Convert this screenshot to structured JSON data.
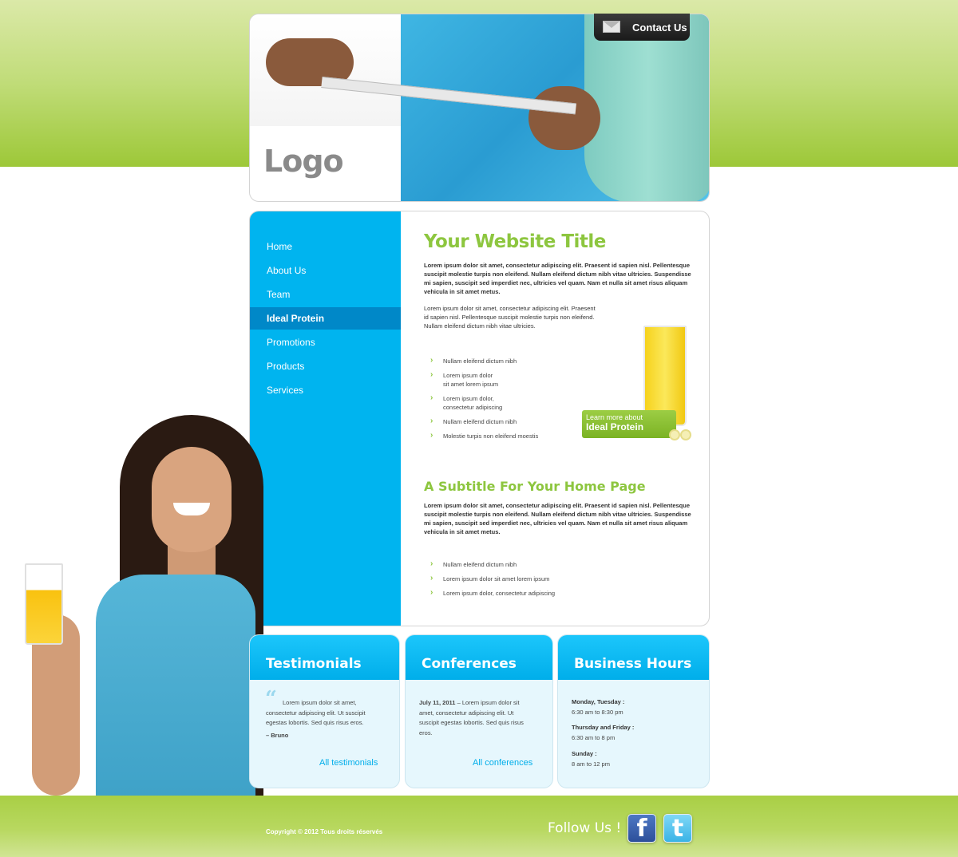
{
  "header": {
    "logo": "Logo",
    "contact_label": "Contact Us"
  },
  "nav": {
    "items": [
      {
        "label": "Home",
        "active": false
      },
      {
        "label": "About Us",
        "active": false
      },
      {
        "label": "Team",
        "active": false
      },
      {
        "label": "Ideal Protein",
        "active": true
      },
      {
        "label": "Promotions",
        "active": false
      },
      {
        "label": "Products",
        "active": false
      },
      {
        "label": "Services",
        "active": false
      }
    ]
  },
  "main": {
    "title": "Your Website Title",
    "intro_bold": "Lorem ipsum dolor sit amet, consectetur adipiscing elit. Praesent id sapien nisl. Pellentesque suscipit molestie turpis non eleifend. Nullam eleifend dictum nibh vitae ultricies. Suspendisse mi sapien, suscipit sed imperdiet nec, ultricies vel quam. Nam et nulla sit amet risus aliquam vehicula in sit amet metus.",
    "intro_regular": "Lorem ipsum dolor sit amet, consectetur adipiscing elit. Praesent id sapien nisl. Pellentesque suscipit molestie turpis non eleifend. Nullam eleifend dictum nibh vitae ultricies.",
    "list1": [
      "Nullam eleifend dictum nibh",
      "Lorem ipsum dolor\nsit amet lorem ipsum",
      "Lorem ipsum dolor,\nconsectetur adipiscing",
      "Nullam eleifend dictum nibh",
      "Molestie turpis non eleifend moestis"
    ],
    "promo_small": "Learn more about",
    "promo_big": "Ideal Protein",
    "subtitle": "A Subtitle For Your Home Page",
    "sub_bold": "Lorem ipsum dolor sit amet, consectetur adipiscing elit. Praesent id sapien nisl. Pellentesque suscipit molestie turpis non eleifend. Nullam eleifend dictum nibh vitae ultricies. Suspendisse mi sapien, suscipit sed imperdiet nec, ultricies vel quam. Nam et nulla sit amet risus aliquam vehicula in sit amet metus.",
    "list2": [
      "Nullam eleifend dictum nibh",
      "Lorem ipsum dolor sit amet lorem ipsum",
      "Lorem ipsum dolor, consectetur adipiscing"
    ]
  },
  "boxes": {
    "testimonials": {
      "title": "Testimonials",
      "quote": "Lorem ipsum dolor sit amet, consectetur adipiscing elit. Ut suscipit egestas lobortis. Sed quis risus eros.",
      "author": "– Bruno",
      "link": "All testimonials"
    },
    "conferences": {
      "title": "Conferences",
      "date": "July 11, 2011",
      "text": "Lorem ipsum dolor sit amet, consectetur adipiscing elit. Ut suscipit egestas lobortis. Sed quis risus eros.",
      "link": "All conferences"
    },
    "hours": {
      "title": "Business Hours",
      "rows": [
        {
          "day": "Monday, Tuesday :",
          "time": "6:30 am to 8:30 pm"
        },
        {
          "day": "Thursday and Friday :",
          "time": "6:30 am to 8 pm"
        },
        {
          "day": "Sunday :",
          "time": "8 am to 12 pm"
        }
      ]
    }
  },
  "footer": {
    "copyright": "Copyright © 2012 Tous droits réservés",
    "follow": "Follow Us !",
    "facebook_glyph": "f",
    "twitter_glyph": "t"
  },
  "colors": {
    "accent_green": "#8dc63f",
    "accent_blue": "#00b4ef",
    "nav_active": "#0088c8"
  }
}
